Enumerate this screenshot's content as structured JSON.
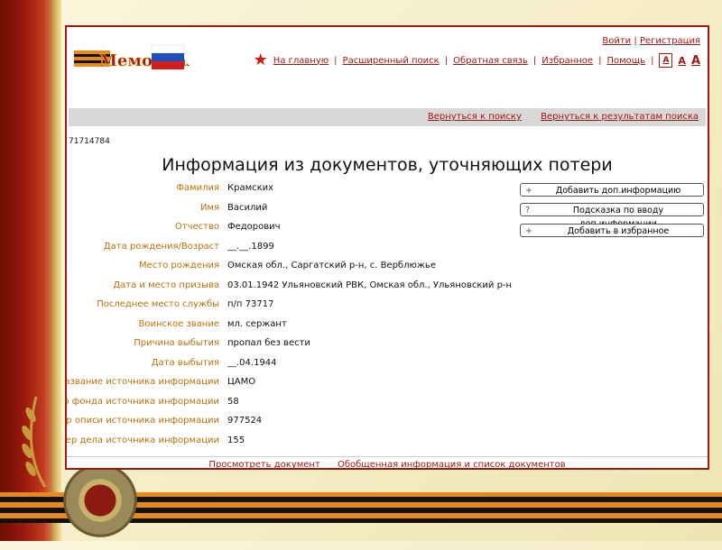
{
  "header": {
    "logo_text": "МемориаЛ",
    "login": "Войти",
    "register": "Регистрация",
    "nav": [
      "На главную",
      "Расширенный поиск",
      "Обратная связь",
      "Избранное",
      "Помощь"
    ],
    "font_sizes": [
      "A",
      "A",
      "A"
    ]
  },
  "toolbar": {
    "back_to_search": "Вернуться к поиску",
    "back_to_results": "Вернуться к результатам поиска"
  },
  "record": {
    "id": "71714784",
    "title": "Информация из документов, уточняющих потери",
    "fields": [
      {
        "label": "Фамилия",
        "value": "Крамских"
      },
      {
        "label": "Имя",
        "value": "Василий"
      },
      {
        "label": "Отчество",
        "value": "Федорович"
      },
      {
        "label": "Дата рождения/Возраст",
        "value": "__.__.1899"
      },
      {
        "label": "Место рождения",
        "value": "Омская обл., Саргатский р-н, с. Верблюжье"
      },
      {
        "label": "Дата и место призыва",
        "value": "03.01.1942 Ульяновский РВК, Омская обл., Ульяновский р-н"
      },
      {
        "label": "Последнее место службы",
        "value": "п/п 73717"
      },
      {
        "label": "Воинское звание",
        "value": "мл. сержант"
      },
      {
        "label": "Причина выбытия",
        "value": "пропал без вести"
      },
      {
        "label": "Дата выбытия",
        "value": "__.04.1944"
      },
      {
        "label": "Название источника информации",
        "value": "ЦАМО"
      },
      {
        "label": "Номер фонда источника информации",
        "value": "58"
      },
      {
        "label": "Номер описи источника информации",
        "value": "977524"
      },
      {
        "label": "Номер дела источника информации",
        "value": "155"
      }
    ]
  },
  "actions": [
    {
      "icon": "+",
      "label": "Добавить доп.информацию"
    },
    {
      "icon": "?",
      "label": "Подсказка по вводу доп.информации"
    },
    {
      "icon": "+",
      "label": "Добавить в избранное"
    }
  ],
  "footer": {
    "view_document": "Просмотреть документ",
    "summary": "Обобщенная информация и список документов"
  },
  "colors": {
    "accent": "#a01812",
    "label": "#b8700a",
    "ribbon_orange": "#e8891c",
    "ribbon_black": "#111111"
  },
  "icons": [
    "star-icon",
    "plus-icon",
    "question-icon",
    "flag-icon",
    "medal-icon"
  ]
}
